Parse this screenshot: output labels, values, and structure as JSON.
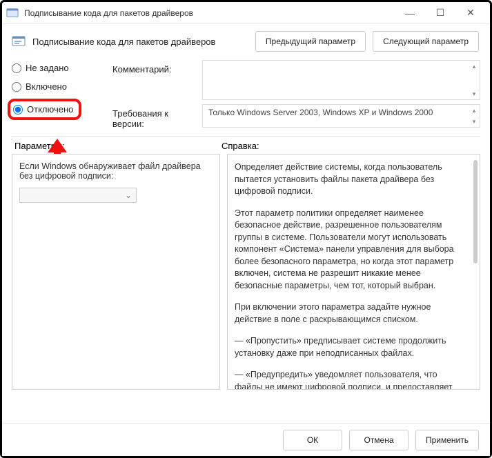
{
  "window": {
    "title": "Подписывание кода для пакетов драйверов"
  },
  "header": {
    "title": "Подписывание кода для пакетов драйверов",
    "prev": "Предыдущий параметр",
    "next": "Следующий параметр"
  },
  "radios": {
    "not_configured": "Не задано",
    "enabled": "Включено",
    "disabled": "Отключено"
  },
  "labels": {
    "comment": "Комментарий:",
    "requirements": "Требования к версии:",
    "requirements_value": "Только Windows Server 2003, Windows XP и Windows 2000",
    "options": "Параметры:",
    "help": "Справка:"
  },
  "options_panel": {
    "text": "Если Windows обнаруживает файл драйвера без цифровой подписи:"
  },
  "help": {
    "p1": "Определяет действие системы, когда пользователь пытается установить файлы пакета драйвера без цифровой подписи.",
    "p2": "Этот параметр политики определяет наименее безопасное действие, разрешенное пользователям группы в системе. Пользователи могут использовать компонент «Система» панели управления для выбора более безопасного параметра, но когда этот параметр включен, система не разрешит никакие менее безопасные параметры, чем тот, который выбран.",
    "p3": "При включении этого параметра задайте нужное действие в поле с раскрывающимся списком.",
    "p4": "—   «Пропустить» предписывает системе продолжить установку даже при неподписанных файлах.",
    "p5": "—   «Предупредить» уведомляет пользователя, что файлы не имеют цифровой подписи, и предоставляет пользователю возможность решить, остановить установку или продолжить, и разрешить ли установку неподписанных файлов. Параметр"
  },
  "footer": {
    "ok": "ОК",
    "cancel": "Отмена",
    "apply": "Применить"
  }
}
